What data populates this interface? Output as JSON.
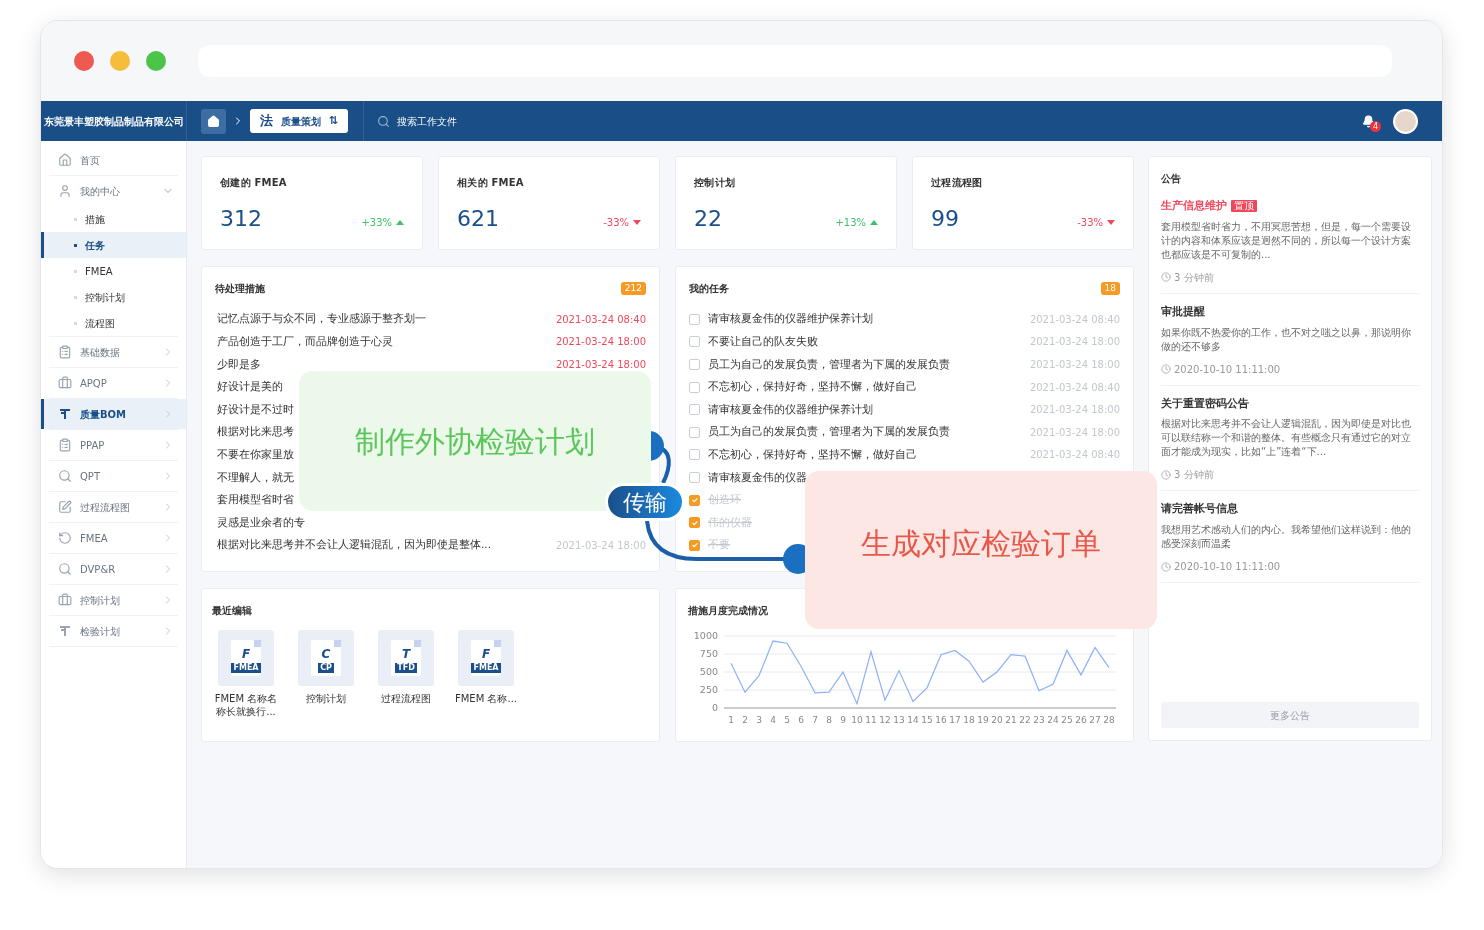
{
  "header": {
    "company": "东莞景丰塑胶制品制品有限公司",
    "breadcrumb": {
      "glyph": "法",
      "label": "质量策划",
      "switch_glyph": "⇅"
    },
    "search": {
      "placeholder": "搜索工作文件"
    },
    "notification_count": "4"
  },
  "sidebar": {
    "items": [
      {
        "label": "首页",
        "selected": false
      },
      {
        "label": "我的中心",
        "selected": false,
        "expanded": true,
        "children": [
          {
            "label": "措施",
            "selected": false
          },
          {
            "label": "任务",
            "selected": true
          },
          {
            "label": "FMEA",
            "selected": false
          },
          {
            "label": "控制计划",
            "selected": false
          },
          {
            "label": "流程图",
            "selected": false
          }
        ]
      },
      {
        "label": "基础数据",
        "selected": false,
        "expanded": false
      },
      {
        "label": "APQP",
        "selected": false,
        "expanded": false
      },
      {
        "label": "质量BOM",
        "selected": true,
        "expanded": false
      },
      {
        "label": "PPAP",
        "selected": false,
        "expanded": false
      },
      {
        "label": "QPT",
        "selected": false,
        "expanded": false
      },
      {
        "label": "过程流程图",
        "selected": false,
        "expanded": false
      },
      {
        "label": "FMEA",
        "selected": false,
        "expanded": false
      },
      {
        "label": "DVP&R",
        "selected": false,
        "expanded": false
      },
      {
        "label": "控制计划",
        "selected": false,
        "expanded": false
      },
      {
        "label": "检验计划",
        "selected": false,
        "expanded": false
      }
    ]
  },
  "stats": [
    {
      "title": "创建的 FMEA",
      "value": "312",
      "change": "+33%",
      "rising": true
    },
    {
      "title": "相关的 FMEA",
      "value": "621",
      "change": "-33%",
      "rising": false
    },
    {
      "title": "控制计划",
      "value": "22",
      "change": "+13%",
      "rising": true
    },
    {
      "title": "过程流程图",
      "value": "99",
      "change": "-33%",
      "rising": false
    }
  ],
  "pending": {
    "title": "待处理措施",
    "count": "212",
    "rows": [
      {
        "text": "记忆点源于与众不同，专业感源于整齐划一",
        "time": "2021-03-24 08:40",
        "overdue": true
      },
      {
        "text": "产品创造于工厂，而品牌创造于心灵",
        "time": "2021-03-24 18:00",
        "overdue": true
      },
      {
        "text": "少即是多",
        "time": "2021-03-24 18:00",
        "overdue": true
      },
      {
        "text": "好设计是美的"
      },
      {
        "text": "好设计是不过时"
      },
      {
        "text": "根据对比来思考"
      },
      {
        "text": "不要在你家里放"
      },
      {
        "text": "不理解人，就无"
      },
      {
        "text": "套用模型省时省"
      },
      {
        "text": "灵感是业余者的专"
      },
      {
        "text": "根据对比来思考并不会让人逻辑混乱，因为即使是整体...",
        "time": "2021-03-24 18:00",
        "overdue": false
      }
    ]
  },
  "tasks": {
    "title": "我的任务",
    "count": "18",
    "rows": [
      {
        "text": "请审核夏金伟的仪器维护保养计划",
        "time": "2021-03-24 08:40",
        "checked": false
      },
      {
        "text": "不要让自己的队友失败",
        "time": "2021-03-24 18:00",
        "checked": false
      },
      {
        "text": "员工为自己的发展负责，管理者为下属的发展负责",
        "time": "2021-03-24 18:00",
        "checked": false
      },
      {
        "text": "不忘初心，保持好奇，坚持不懈，做好自己",
        "time": "2021-03-24 08:40",
        "checked": false
      },
      {
        "text": "请审核夏金伟的仪器维护保养计划",
        "time": "2021-03-24 18:00",
        "checked": false
      },
      {
        "text": "员工为自己的发展负责，管理者为下属的发展负责",
        "time": "2021-03-24 18:00",
        "checked": false
      },
      {
        "text": "不忘初心，保持好奇，坚持不懈，做好自己",
        "time": "2021-03-24 08:40",
        "checked": false
      },
      {
        "text": "请审核夏金伟的仪器",
        "checked": false
      },
      {
        "text": "创造环",
        "checked": true
      },
      {
        "text": "伟的仪器",
        "checked": true
      },
      {
        "text": "不要",
        "checked": true
      }
    ]
  },
  "recent": {
    "title": "最近编辑",
    "files": [
      {
        "letter": "F",
        "tag": "FMEA",
        "name": "FMEM 名称名称长就换行..."
      },
      {
        "letter": "C",
        "tag": "CP",
        "name": "控制计划"
      },
      {
        "letter": "T",
        "tag": "TFD",
        "name": "过程流程图"
      },
      {
        "letter": "F",
        "tag": "FMEA",
        "name": "FMEM 名称..."
      }
    ]
  },
  "monthly": {
    "title": "措施月度完成情况",
    "chart_data": {
      "type": "line",
      "x": [
        1,
        2,
        3,
        4,
        5,
        6,
        7,
        8,
        9,
        10,
        11,
        12,
        13,
        14,
        15,
        16,
        17,
        18,
        19,
        20,
        21,
        22,
        23,
        24,
        25,
        26,
        27,
        28
      ],
      "series": [
        {
          "color": "#8fb0f5",
          "values": [
            620,
            220,
            450,
            930,
            900,
            580,
            210,
            220,
            500,
            60,
            780,
            110,
            520,
            90,
            280,
            740,
            800,
            650,
            360,
            500,
            740,
            720,
            240,
            330,
            800,
            460,
            840,
            560
          ]
        }
      ],
      "xlim": [
        0.5,
        28.5
      ],
      "ylim": [
        0,
        1000
      ],
      "yticks": [
        0,
        250,
        500,
        750,
        1000
      ],
      "xticks": [
        1,
        2,
        3,
        4,
        5,
        6,
        7,
        8,
        9,
        10,
        11,
        12,
        13,
        14,
        15,
        16,
        17,
        18,
        19,
        20,
        21,
        22,
        23,
        24,
        25,
        26,
        27,
        28
      ],
      "grid": true
    }
  },
  "notices": {
    "title": "公告",
    "items": [
      {
        "title": "生产信息维护",
        "pinned": true,
        "pin_label": "置顶",
        "body": "套用模型省时省力，不用冥思苦想，但是，每一个需要设计的内容和体系应该是迥然不同的，所以每一个设计方案也都应该是不可复制的...",
        "time": "3 分钟前"
      },
      {
        "title": "审批提醒",
        "pinned": false,
        "body": "如果你既不热爱你的工作，也不对之嗤之以鼻，那说明你做的还不够多",
        "time": "2020-10-10 11:11:00"
      },
      {
        "title": "关于重置密码公告",
        "pinned": false,
        "body": "根据对比来思考并不会让人逻辑混乱，因为即使是对比也可以联结称一个和谐的整体。有些概念只有通过它的对立面才能成为现实，比如“上”连着“下...",
        "time": "3 分钟前"
      },
      {
        "title": "请完善帐号信息",
        "pinned": false,
        "body": "我想用艺术感动人们的内心。我希望他们这样说到：他的感受深刻而温柔",
        "time": "2020-10-10 11:11:00"
      }
    ],
    "more": "更多公告"
  },
  "callouts": [
    {
      "kind": "green",
      "text": "制作外协检验计划"
    },
    {
      "kind": "pill",
      "text": "传输"
    },
    {
      "kind": "pink",
      "text": "生成对应检验订单"
    }
  ]
}
